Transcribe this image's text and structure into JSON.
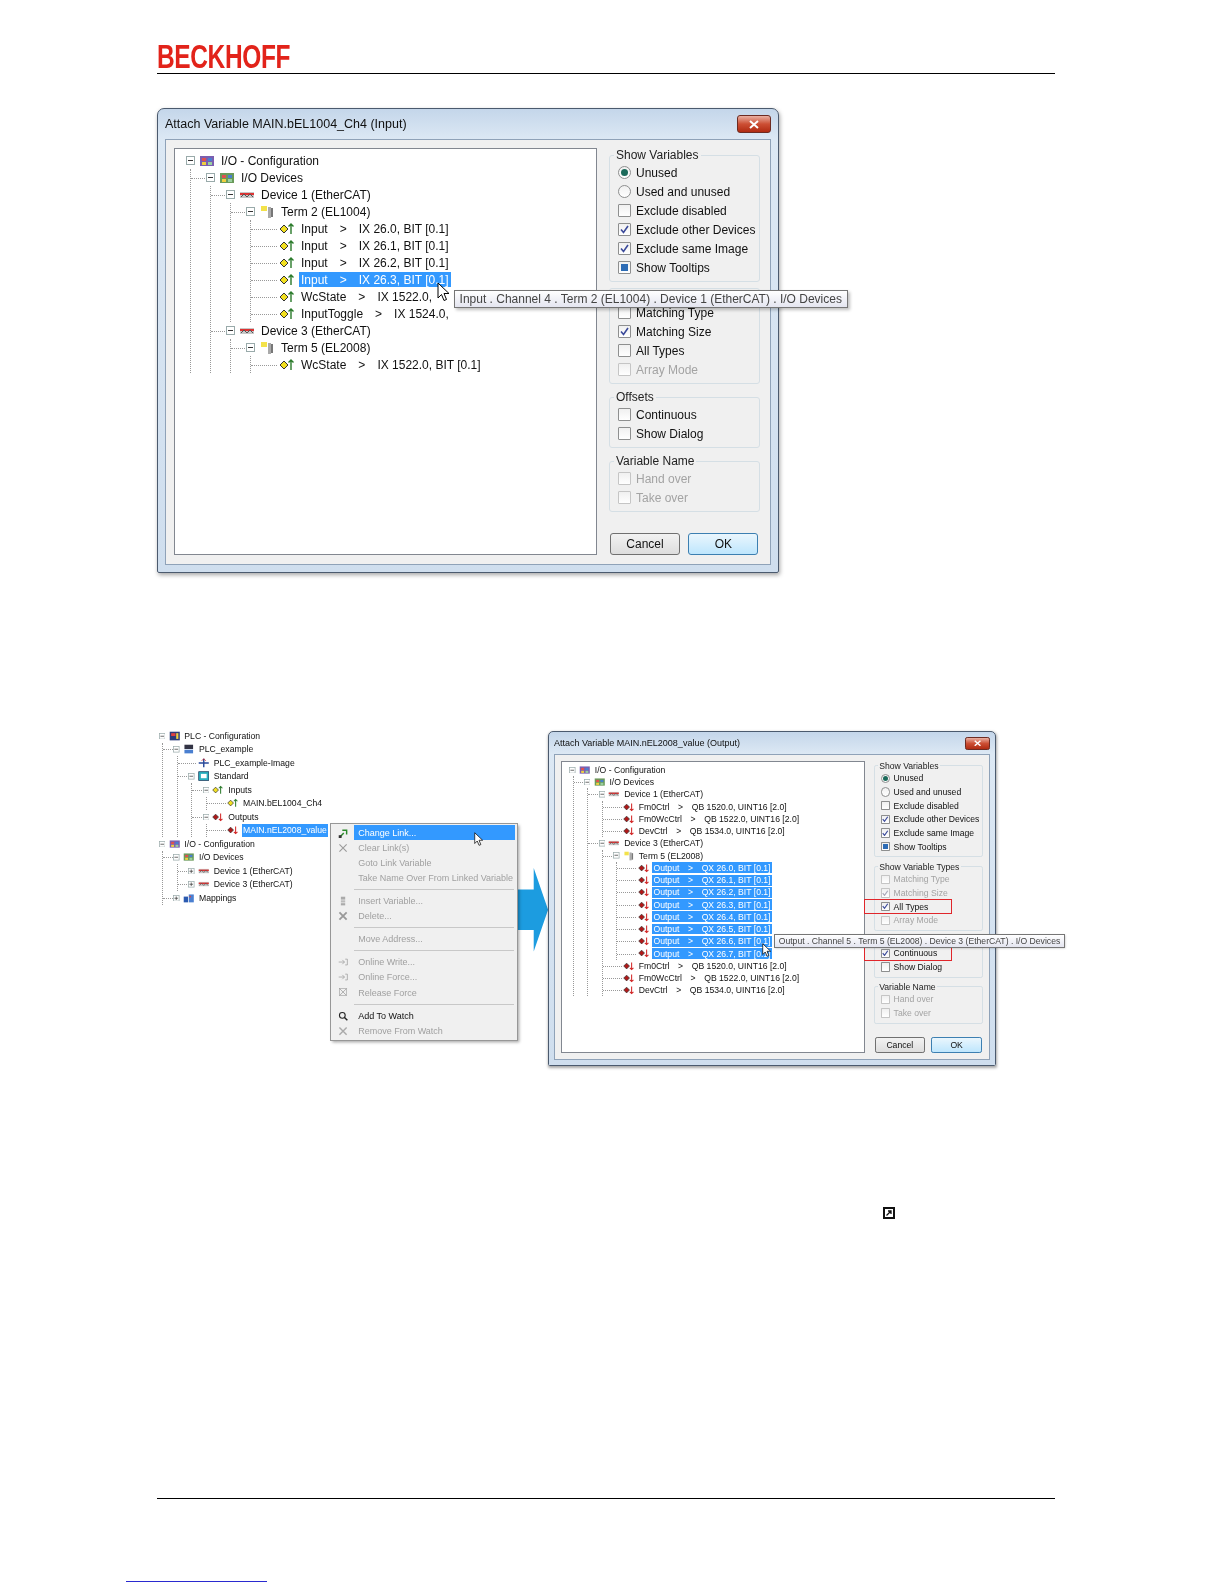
{
  "header": {
    "logo": "BECKHOFF"
  },
  "dialog_input": {
    "title": "Attach Variable MAIN.bEL1004_Ch4 (Input)",
    "tree": [
      {
        "kind": "config",
        "label": "I/O - Configuration",
        "selected": false,
        "expanded": true,
        "children": [
          {
            "kind": "devices",
            "label": "I/O Devices",
            "selected": false,
            "expanded": true,
            "children": [
              {
                "kind": "device",
                "label": "Device 1 (EtherCAT)",
                "selected": false,
                "expanded": true,
                "children": [
                  {
                    "kind": "term",
                    "label": "Term 2 (EL1004)",
                    "selected": false,
                    "expanded": true,
                    "children": [
                      {
                        "kind": "input",
                        "label": "Input",
                        "arrow": ">",
                        "address": "IX 26.0, BIT [0.1]",
                        "selected": false
                      },
                      {
                        "kind": "input",
                        "label": "Input",
                        "arrow": ">",
                        "address": "IX 26.1, BIT [0.1]",
                        "selected": false
                      },
                      {
                        "kind": "input",
                        "label": "Input",
                        "arrow": ">",
                        "address": "IX 26.2, BIT [0.1]",
                        "selected": false
                      },
                      {
                        "kind": "input",
                        "label": "Input",
                        "arrow": ">",
                        "address": "IX 26.3, BIT [0.1]",
                        "selected": true,
                        "tooltip": "Input . Channel 4 . Term 2 (EL1004) . Device 1 (EtherCAT) . I/O Devices"
                      },
                      {
                        "kind": "input",
                        "label": "WcState",
                        "arrow": ">",
                        "address": "IX 1522.0,",
                        "selected": false
                      },
                      {
                        "kind": "input",
                        "label": "InputToggle",
                        "arrow": ">",
                        "address": "IX 1524.0,",
                        "selected": false
                      }
                    ]
                  }
                ]
              },
              {
                "kind": "device",
                "label": "Device 3 (EtherCAT)",
                "selected": false,
                "expanded": true,
                "children": [
                  {
                    "kind": "term",
                    "label": "Term 5 (EL2008)",
                    "selected": false,
                    "expanded": true,
                    "children": [
                      {
                        "kind": "input",
                        "label": "WcState",
                        "arrow": ">",
                        "address": "IX 1522.0, BIT [0.1]",
                        "selected": false
                      }
                    ]
                  }
                ]
              }
            ]
          }
        ]
      }
    ],
    "groups": [
      {
        "title": "Show Variables",
        "options": [
          {
            "kind": "radio",
            "label": "Unused",
            "checked": true,
            "disabled": false
          },
          {
            "kind": "radio",
            "label": "Used and unused",
            "checked": false,
            "disabled": false
          },
          {
            "kind": "checkbox",
            "label": "Exclude disabled",
            "checked": false,
            "disabled": false
          },
          {
            "kind": "checkbox",
            "label": "Exclude other Devices",
            "checked": true,
            "disabled": false
          },
          {
            "kind": "checkbox",
            "label": "Exclude same Image",
            "checked": true,
            "disabled": false
          },
          {
            "kind": "tristate",
            "label": "Show Tooltips",
            "checked": true,
            "disabled": false
          }
        ]
      },
      {
        "options": [
          {
            "kind": "checkbox",
            "label": "Matching Type",
            "checked": false,
            "disabled": false
          },
          {
            "kind": "checkbox",
            "label": "Matching Size",
            "checked": true,
            "disabled": false
          },
          {
            "kind": "checkbox",
            "label": "All Types",
            "checked": false,
            "disabled": false
          },
          {
            "kind": "checkbox",
            "label": "Array Mode",
            "checked": false,
            "disabled": true
          }
        ]
      },
      {
        "title": "Offsets",
        "options": [
          {
            "kind": "checkbox",
            "label": "Continuous",
            "checked": false,
            "disabled": false
          },
          {
            "kind": "checkbox",
            "label": "Show Dialog",
            "checked": false,
            "disabled": false
          }
        ]
      },
      {
        "title": "Variable Name",
        "options": [
          {
            "kind": "checkbox",
            "label": "Hand over",
            "checked": false,
            "disabled": true
          },
          {
            "kind": "checkbox",
            "label": "Take over",
            "checked": false,
            "disabled": true
          }
        ]
      }
    ],
    "buttons": [
      {
        "label": "Cancel",
        "default": false
      },
      {
        "label": "OK",
        "default": true
      }
    ]
  },
  "plc_tree": [
    {
      "kind": "plc",
      "label": "PLC - Configuration",
      "selected": false,
      "expanded": true,
      "children": [
        {
          "kind": "project",
          "label": "PLC_example",
          "selected": false,
          "expanded": true,
          "children": [
            {
              "kind": "image",
              "label": "PLC_example-Image",
              "selected": false
            },
            {
              "kind": "task",
              "label": "Standard",
              "selected": false,
              "expanded": true,
              "children": [
                {
                  "kind": "inputs",
                  "label": "Inputs",
                  "selected": false,
                  "expanded": true,
                  "children": [
                    {
                      "kind": "input",
                      "label": "MAIN.bEL1004_Ch4",
                      "selected": false
                    }
                  ]
                },
                {
                  "kind": "outputs",
                  "label": "Outputs",
                  "selected": false,
                  "expanded": true,
                  "children": [
                    {
                      "kind": "output",
                      "label": "MAIN.nEL2008_value",
                      "selected": true
                    }
                  ]
                }
              ]
            }
          ]
        }
      ]
    },
    {
      "kind": "config",
      "label": "I/O - Configuration",
      "selected": false,
      "expanded": true,
      "children": [
        {
          "kind": "devices",
          "label": "I/O Devices",
          "selected": false,
          "expanded": true,
          "children": [
            {
              "kind": "device",
              "label": "Device 1 (EtherCAT)",
              "selected": false,
              "expanded": false
            },
            {
              "kind": "device",
              "label": "Device 3 (EtherCAT)",
              "selected": false,
              "expanded": false
            }
          ]
        },
        {
          "kind": "mappings",
          "label": "Mappings",
          "selected": false,
          "expanded": false
        }
      ]
    }
  ],
  "context_menu": {
    "items": [
      {
        "kind": "item",
        "label": "Change Link...",
        "selected": true,
        "disabled": false
      },
      {
        "kind": "item",
        "label": "Clear Link(s)",
        "selected": false,
        "disabled": true
      },
      {
        "kind": "item",
        "label": "Goto Link Variable",
        "selected": false,
        "disabled": true
      },
      {
        "kind": "item",
        "label": "Take Name Over From Linked Variable",
        "selected": false,
        "disabled": true
      },
      {
        "kind": "separator"
      },
      {
        "kind": "item",
        "label": "Insert Variable...",
        "selected": false,
        "disabled": true
      },
      {
        "kind": "item",
        "label": "Delete...",
        "selected": false,
        "disabled": true
      },
      {
        "kind": "separator"
      },
      {
        "kind": "item",
        "label": "Move Address...",
        "selected": false,
        "disabled": true
      },
      {
        "kind": "separator"
      },
      {
        "kind": "item",
        "label": "Online Write...",
        "selected": false,
        "disabled": true
      },
      {
        "kind": "item",
        "label": "Online Force...",
        "selected": false,
        "disabled": true
      },
      {
        "kind": "item",
        "label": "Release Force",
        "selected": false,
        "disabled": true
      },
      {
        "kind": "separator"
      },
      {
        "kind": "item",
        "label": "Add To Watch",
        "selected": false,
        "disabled": false
      },
      {
        "kind": "item",
        "label": "Remove From Watch",
        "selected": false,
        "disabled": true
      }
    ]
  },
  "dialog_output": {
    "title": "Attach Variable MAIN.nEL2008_value (Output)",
    "tree": [
      {
        "kind": "config",
        "label": "I/O - Configuration",
        "selected": false,
        "expanded": true,
        "children": [
          {
            "kind": "devices",
            "label": "I/O Devices",
            "selected": false,
            "expanded": true,
            "children": [
              {
                "kind": "device",
                "label": "Device 1 (EtherCAT)",
                "selected": false,
                "expanded": true,
                "children": [
                  {
                    "kind": "output",
                    "label": "Fm0Ctrl",
                    "arrow": ">",
                    "address": "QB 1520.0, UINT16 [2.0]",
                    "selected": false
                  },
                  {
                    "kind": "output",
                    "label": "Fm0WcCtrl",
                    "arrow": ">",
                    "address": "QB 1522.0, UINT16 [2.0]",
                    "selected": false
                  },
                  {
                    "kind": "output",
                    "label": "DevCtrl",
                    "arrow": ">",
                    "address": "QB 1534.0, UINT16 [2.0]",
                    "selected": false
                  }
                ]
              },
              {
                "kind": "device",
                "label": "Device 3 (EtherCAT)",
                "selected": false,
                "expanded": true,
                "children": [
                  {
                    "kind": "term",
                    "label": "Term 5 (EL2008)",
                    "selected": false,
                    "expanded": true,
                    "children": [
                      {
                        "kind": "output",
                        "label": "Output",
                        "arrow": ">",
                        "address": "QX 26.0, BIT [0.1]",
                        "selected": true
                      },
                      {
                        "kind": "output",
                        "label": "Output",
                        "arrow": ">",
                        "address": "QX 26.1, BIT [0.1]",
                        "selected": true
                      },
                      {
                        "kind": "output",
                        "label": "Output",
                        "arrow": ">",
                        "address": "QX 26.2, BIT [0.1]",
                        "selected": true
                      },
                      {
                        "kind": "output",
                        "label": "Output",
                        "arrow": ">",
                        "address": "QX 26.3, BIT [0.1]",
                        "selected": true
                      },
                      {
                        "kind": "output",
                        "label": "Output",
                        "arrow": ">",
                        "address": "QX 26.4, BIT [0.1]",
                        "selected": true
                      },
                      {
                        "kind": "output",
                        "label": "Output",
                        "arrow": ">",
                        "address": "QX 26.5, BIT [0.1]",
                        "selected": true
                      },
                      {
                        "kind": "output",
                        "label": "Output",
                        "arrow": ">",
                        "address": "QX 26.6, BIT [0.1]",
                        "selected": true,
                        "tooltip": "Output . Channel 5 . Term 5 (EL2008) . Device 3 (EtherCAT) . I/O Devices"
                      },
                      {
                        "kind": "output",
                        "label": "Output",
                        "arrow": ">",
                        "address": "QX 26.7, BIT [0.1]",
                        "selected": true
                      }
                    ]
                  },
                  {
                    "kind": "output",
                    "label": "Fm0Ctrl",
                    "arrow": ">",
                    "address": "QB 1520.0, UINT16 [2.0]",
                    "selected": false
                  },
                  {
                    "kind": "output",
                    "label": "Fm0WcCtrl",
                    "arrow": ">",
                    "address": "QB 1522.0, UINT16 [2.0]",
                    "selected": false
                  },
                  {
                    "kind": "output",
                    "label": "DevCtrl",
                    "arrow": ">",
                    "address": "QB 1534.0, UINT16 [2.0]",
                    "selected": false
                  }
                ]
              }
            ]
          }
        ]
      }
    ],
    "groups": [
      {
        "title": "Show Variables",
        "options": [
          {
            "kind": "radio",
            "label": "Unused",
            "checked": true,
            "disabled": false,
            "highlighted": false
          },
          {
            "kind": "radio",
            "label": "Used and unused",
            "checked": false,
            "disabled": false,
            "highlighted": false
          },
          {
            "kind": "checkbox",
            "label": "Exclude disabled",
            "checked": false,
            "disabled": false,
            "highlighted": false
          },
          {
            "kind": "checkbox",
            "label": "Exclude other Devices",
            "checked": true,
            "disabled": false,
            "highlighted": false
          },
          {
            "kind": "checkbox",
            "label": "Exclude same Image",
            "checked": true,
            "disabled": false,
            "highlighted": false
          },
          {
            "kind": "tristate",
            "label": "Show Tooltips",
            "checked": true,
            "disabled": false,
            "highlighted": false
          }
        ]
      },
      {
        "title": "Show Variable Types",
        "options": [
          {
            "kind": "checkbox",
            "label": "Matching Type",
            "checked": false,
            "disabled": true,
            "highlighted": false
          },
          {
            "kind": "checkbox",
            "label": "Matching Size",
            "checked": true,
            "disabled": true,
            "highlighted": false
          },
          {
            "kind": "checkbox",
            "label": "All Types",
            "checked": true,
            "disabled": false,
            "highlighted": true
          },
          {
            "kind": "checkbox",
            "label": "Array Mode",
            "checked": false,
            "disabled": true,
            "highlighted": false
          }
        ]
      },
      {
        "options": [
          {
            "kind": "checkbox",
            "label": "Continuous",
            "checked": true,
            "disabled": false,
            "highlighted": true
          },
          {
            "kind": "checkbox",
            "label": "Show Dialog",
            "checked": false,
            "disabled": false,
            "highlighted": false
          }
        ]
      },
      {
        "title": "Variable Name",
        "options": [
          {
            "kind": "checkbox",
            "label": "Hand over",
            "checked": false,
            "disabled": true,
            "highlighted": false
          },
          {
            "kind": "checkbox",
            "label": "Take over",
            "checked": false,
            "disabled": true,
            "highlighted": false
          }
        ]
      }
    ],
    "buttons": [
      {
        "label": "Cancel",
        "default": false
      },
      {
        "label": "OK",
        "default": true
      }
    ]
  }
}
